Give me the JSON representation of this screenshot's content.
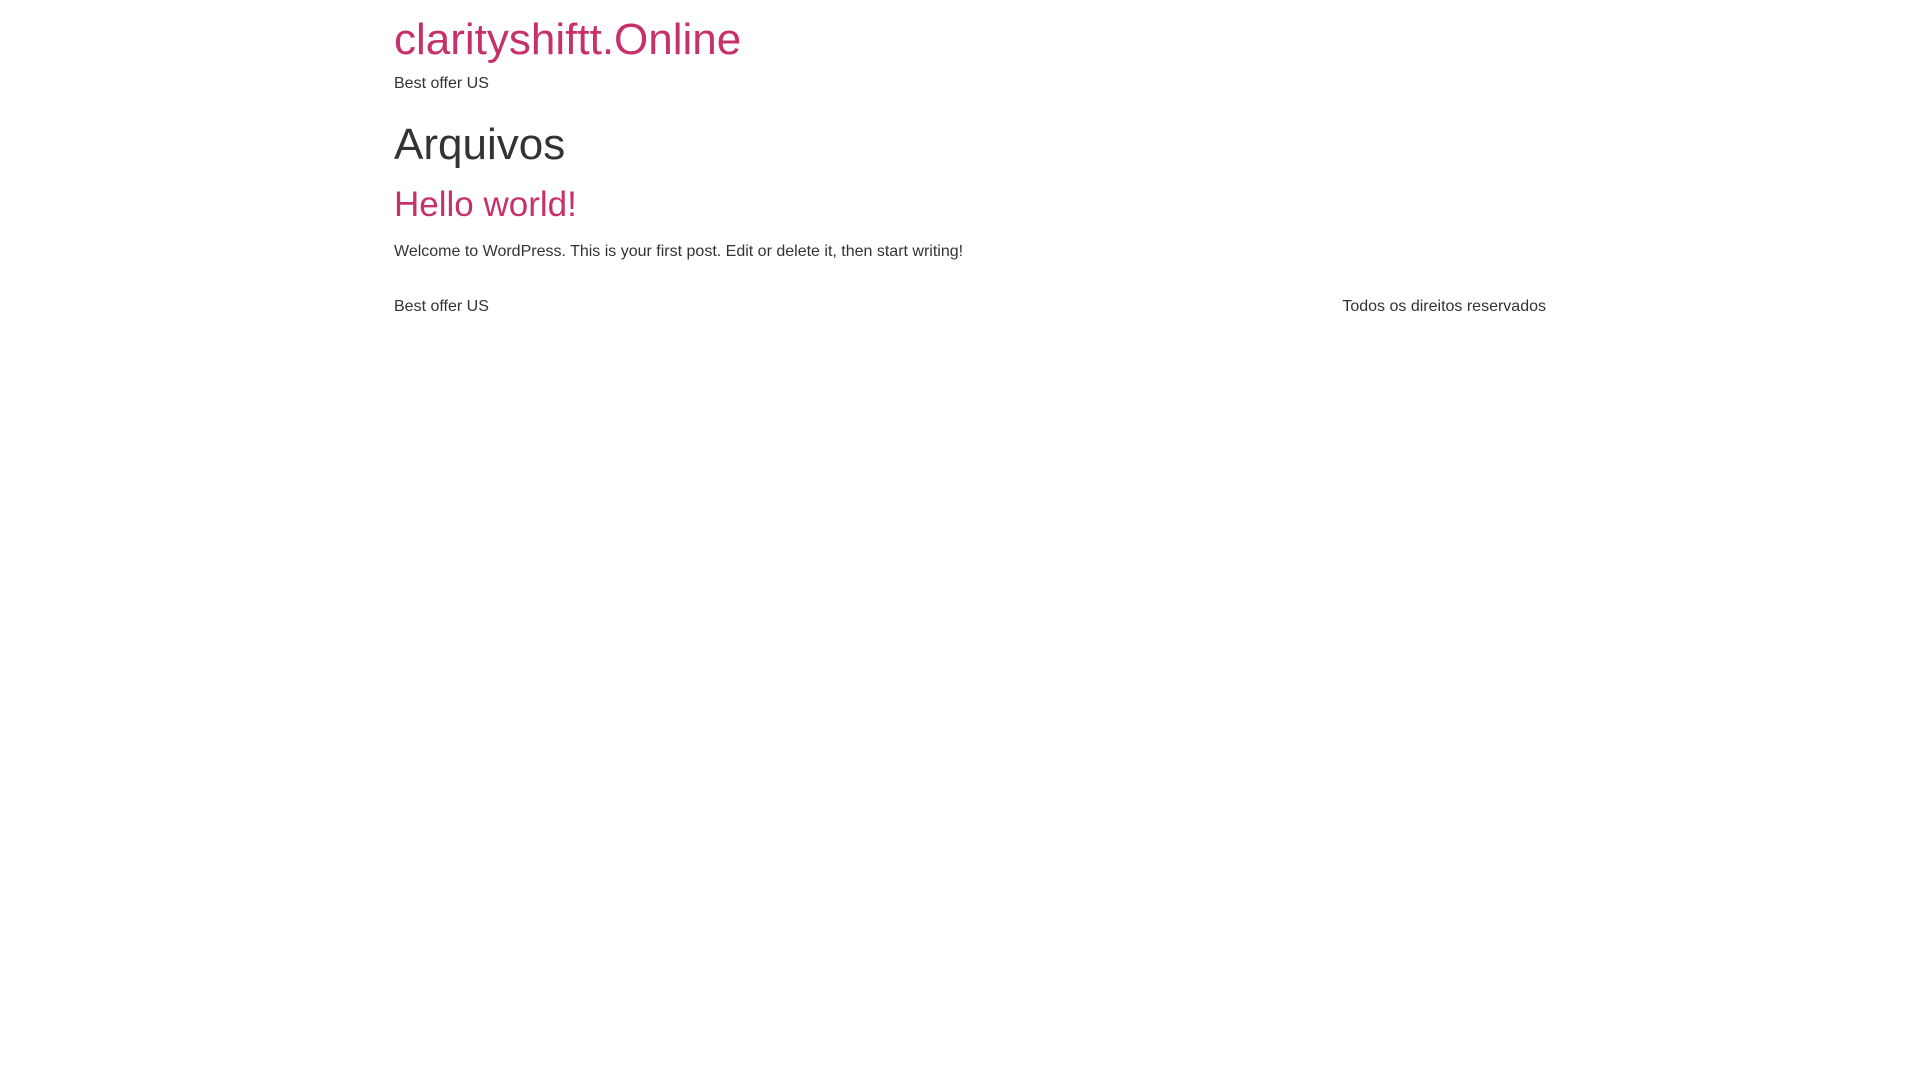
{
  "header": {
    "site_title": "clarityshiftt.Online",
    "tagline": "Best offer US"
  },
  "main": {
    "archive_title": "Arquivos",
    "posts": [
      {
        "title": "Hello world!",
        "excerpt": "Welcome to WordPress. This is your first post. Edit or delete it, then start writing!"
      }
    ]
  },
  "footer": {
    "left_text": "Best offer US",
    "right_text": "Todos os direitos reservados"
  },
  "colors": {
    "accent": "#c7316a",
    "text": "#333333",
    "background": "#ffffff"
  }
}
